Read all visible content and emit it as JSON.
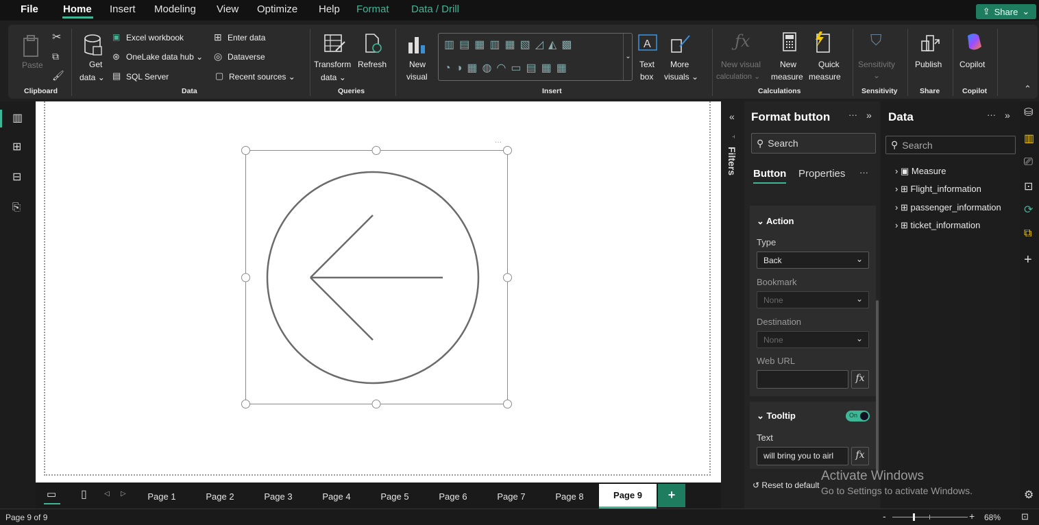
{
  "menu": {
    "items": [
      "File",
      "Home",
      "Insert",
      "Modeling",
      "View",
      "Optimize",
      "Help",
      "Format",
      "Data / Drill"
    ],
    "share": "Share"
  },
  "ribbon": {
    "clipboard": {
      "paste": "Paste",
      "group": "Clipboard"
    },
    "data": {
      "get_data_1": "Get",
      "get_data_2": "data",
      "excel": "Excel workbook",
      "onelake": "OneLake data hub",
      "sql": "SQL Server",
      "enter": "Enter data",
      "dataverse": "Dataverse",
      "recent": "Recent sources",
      "group": "Data"
    },
    "queries": {
      "transform_1": "Transform",
      "transform_2": "data",
      "refresh": "Refresh",
      "group": "Queries"
    },
    "insert": {
      "new_visual_1": "New",
      "new_visual_2": "visual",
      "text_box_1": "Text",
      "text_box_2": "box",
      "more_visuals_1": "More",
      "more_visuals_2": "visuals",
      "group": "Insert"
    },
    "calculations": {
      "new_visual_calc_1": "New visual",
      "new_visual_calc_2": "calculation",
      "new_measure_1": "New",
      "new_measure_2": "measure",
      "quick_measure_1": "Quick",
      "quick_measure_2": "measure",
      "group": "Calculations"
    },
    "sensitivity": {
      "label": "Sensitivity",
      "group": "Sensitivity"
    },
    "share": {
      "publish": "Publish",
      "group": "Share"
    },
    "copilot": {
      "label": "Copilot",
      "group": "Copilot"
    }
  },
  "filters": {
    "label": "Filters"
  },
  "format_pane": {
    "title": "Format button",
    "search_placeholder": "Search",
    "tabs": {
      "button": "Button",
      "properties": "Properties"
    },
    "action": {
      "header": "Action",
      "type_label": "Type",
      "type_value": "Back",
      "bookmark_label": "Bookmark",
      "bookmark_value": "None",
      "destination_label": "Destination",
      "destination_value": "None",
      "web_url_label": "Web URL",
      "web_url_value": ""
    },
    "tooltip": {
      "header": "Tooltip",
      "toggle": "On",
      "text_label": "Text",
      "text_value": "will bring you to airl"
    },
    "reset": "Reset to default"
  },
  "data_pane": {
    "title": "Data",
    "search_placeholder": "Search",
    "tables": [
      "Measure",
      "Flight_information",
      "passenger_information",
      "ticket_information"
    ]
  },
  "pages": {
    "tabs": [
      "Page 1",
      "Page 2",
      "Page 3",
      "Page 4",
      "Page 5",
      "Page 6",
      "Page 7",
      "Page 8",
      "Page 9"
    ],
    "active_index": 8
  },
  "status": {
    "page": "Page 9 of 9",
    "zoom": "68%"
  },
  "watermark": {
    "line1": "Activate Windows",
    "line2": "Go to Settings to activate Windows."
  },
  "colors": {
    "accent": "#3fb796",
    "canvas": "#ffffff",
    "dark_bg": "#1f1f1f"
  }
}
